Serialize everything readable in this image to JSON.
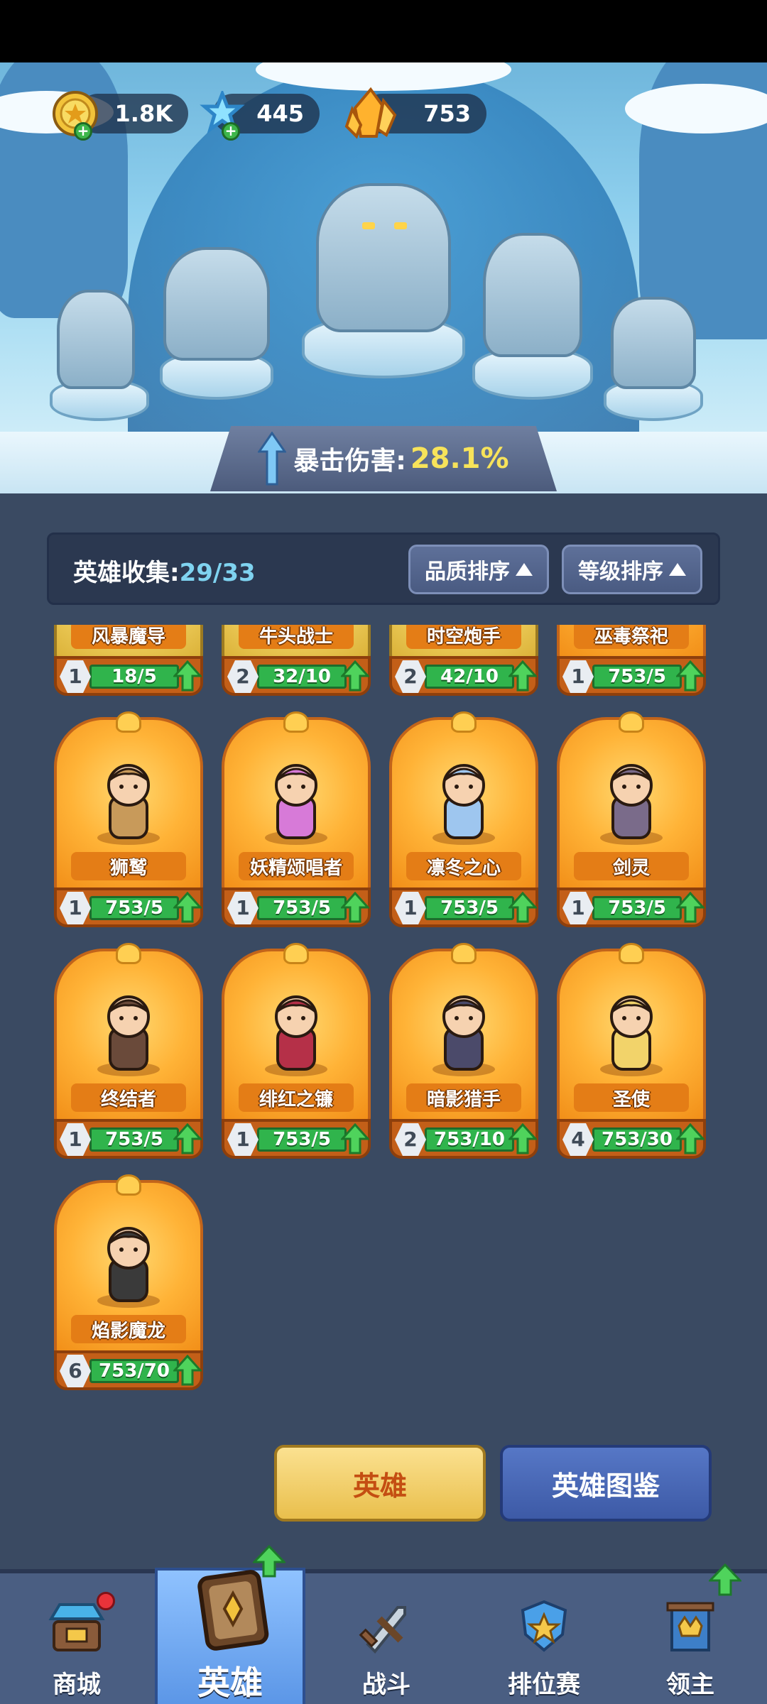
{
  "resources": [
    {
      "name": "coin-icon",
      "value": "1.8K"
    },
    {
      "name": "snowflake-icon",
      "value": "445"
    },
    {
      "name": "crystal-icon",
      "value": "753"
    }
  ],
  "crit": {
    "label": "暴击伤害:",
    "value": "28.1%"
  },
  "collection": {
    "title": "英雄收集:",
    "count": "29/33"
  },
  "sort_buttons": {
    "quality": "品质排序",
    "level": "等级排序"
  },
  "heroes": [
    {
      "name": "风暴魔导",
      "level": "1",
      "progress": "18/5",
      "gold": true
    },
    {
      "name": "牛头战士",
      "level": "2",
      "progress": "32/10",
      "gold": true
    },
    {
      "name": "时空炮手",
      "level": "2",
      "progress": "42/10",
      "gold": true
    },
    {
      "name": "巫毒祭祀",
      "level": "1",
      "progress": "753/5",
      "gold": false
    },
    {
      "name": "狮鹫",
      "level": "1",
      "progress": "753/5",
      "gold": false
    },
    {
      "name": "妖精颂唱者",
      "level": "1",
      "progress": "753/5",
      "gold": false
    },
    {
      "name": "凛冬之心",
      "level": "1",
      "progress": "753/5",
      "gold": false
    },
    {
      "name": "剑灵",
      "level": "1",
      "progress": "753/5",
      "gold": false
    },
    {
      "name": "终结者",
      "level": "1",
      "progress": "753/5",
      "gold": false
    },
    {
      "name": "绯红之镰",
      "level": "1",
      "progress": "753/5",
      "gold": false
    },
    {
      "name": "暗影猎手",
      "level": "2",
      "progress": "753/10",
      "gold": false
    },
    {
      "name": "圣使",
      "level": "4",
      "progress": "753/30",
      "gold": false
    },
    {
      "name": "焰影魔龙",
      "level": "6",
      "progress": "753/70",
      "gold": false
    }
  ],
  "buttons": {
    "hero": "英雄",
    "codex": "英雄图鉴"
  },
  "nav": [
    {
      "label": "商城",
      "icon": "shop-icon"
    },
    {
      "label": "英雄",
      "icon": "hero-card-icon"
    },
    {
      "label": "战斗",
      "icon": "battle-icon"
    },
    {
      "label": "排位赛",
      "icon": "ranked-icon"
    },
    {
      "label": "领主",
      "icon": "lord-icon"
    }
  ],
  "colors": {
    "accent_green": "#30b44c",
    "crit_yellow": "#f7e35a",
    "panel_bg": "#3a4a62"
  }
}
